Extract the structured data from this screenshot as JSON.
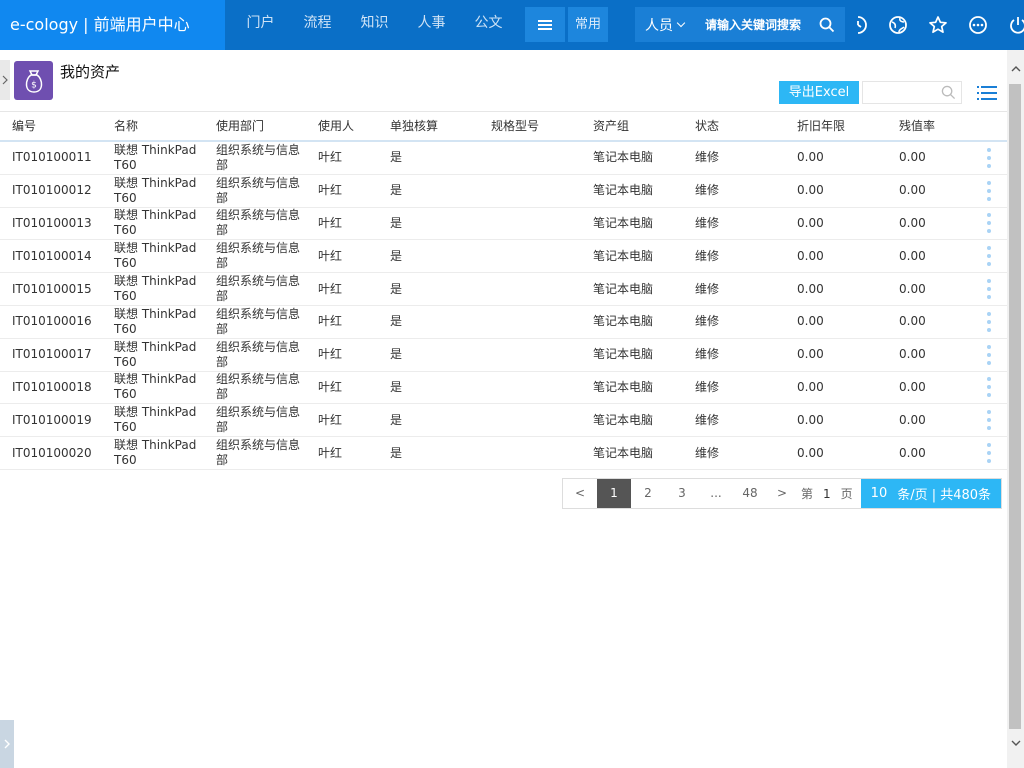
{
  "app": {
    "brand": "e-cology | 前端用户中心"
  },
  "topnav": [
    {
      "label": "门户"
    },
    {
      "label": "流程"
    },
    {
      "label": "知识"
    },
    {
      "label": "人事"
    },
    {
      "label": "公文"
    }
  ],
  "toolbar": {
    "common_label": "常用"
  },
  "search": {
    "scope": "人员",
    "placeholder": "请输入关键词搜索"
  },
  "top_icons": [
    "clock-icon",
    "globe-icon",
    "star-icon",
    "more-icon",
    "power-icon"
  ],
  "page": {
    "title": "我的资产",
    "export_label": "导出Excel"
  },
  "table": {
    "columns": [
      "编号",
      "名称",
      "使用部门",
      "使用人",
      "单独核算",
      "规格型号",
      "资产组",
      "状态",
      "折旧年限",
      "残值率"
    ],
    "rows": [
      [
        "IT010100011",
        "联想 ThinkPad T60",
        "组织系统与信息部",
        "叶红",
        "是",
        "",
        "笔记本电脑",
        "维修",
        "0.00",
        "0.00"
      ],
      [
        "IT010100012",
        "联想 ThinkPad T60",
        "组织系统与信息部",
        "叶红",
        "是",
        "",
        "笔记本电脑",
        "维修",
        "0.00",
        "0.00"
      ],
      [
        "IT010100013",
        "联想 ThinkPad T60",
        "组织系统与信息部",
        "叶红",
        "是",
        "",
        "笔记本电脑",
        "维修",
        "0.00",
        "0.00"
      ],
      [
        "IT010100014",
        "联想 ThinkPad T60",
        "组织系统与信息部",
        "叶红",
        "是",
        "",
        "笔记本电脑",
        "维修",
        "0.00",
        "0.00"
      ],
      [
        "IT010100015",
        "联想 ThinkPad T60",
        "组织系统与信息部",
        "叶红",
        "是",
        "",
        "笔记本电脑",
        "维修",
        "0.00",
        "0.00"
      ],
      [
        "IT010100016",
        "联想 ThinkPad T60",
        "组织系统与信息部",
        "叶红",
        "是",
        "",
        "笔记本电脑",
        "维修",
        "0.00",
        "0.00"
      ],
      [
        "IT010100017",
        "联想 ThinkPad T60",
        "组织系统与信息部",
        "叶红",
        "是",
        "",
        "笔记本电脑",
        "维修",
        "0.00",
        "0.00"
      ],
      [
        "IT010100018",
        "联想 ThinkPad T60",
        "组织系统与信息部",
        "叶红",
        "是",
        "",
        "笔记本电脑",
        "维修",
        "0.00",
        "0.00"
      ],
      [
        "IT010100019",
        "联想 ThinkPad T60",
        "组织系统与信息部",
        "叶红",
        "是",
        "",
        "笔记本电脑",
        "维修",
        "0.00",
        "0.00"
      ],
      [
        "IT010100020",
        "联想 ThinkPad T60",
        "组织系统与信息部",
        "叶红",
        "是",
        "",
        "笔记本电脑",
        "维修",
        "0.00",
        "0.00"
      ]
    ]
  },
  "pagination": {
    "prev": "<",
    "next": ">",
    "pages": [
      "1",
      "2",
      "3",
      "...",
      "48"
    ],
    "current": "1",
    "goto_prefix": "第",
    "goto_value": "1",
    "goto_suffix": "页",
    "page_size": "10",
    "size_suffix": "条/页 | 共480条"
  },
  "colors": {
    "brand_bg": "#1088f0",
    "topbar_bg": "#0a6fc7",
    "accent": "#2db7f5",
    "title_icon_bg": "#6f4fb0"
  }
}
